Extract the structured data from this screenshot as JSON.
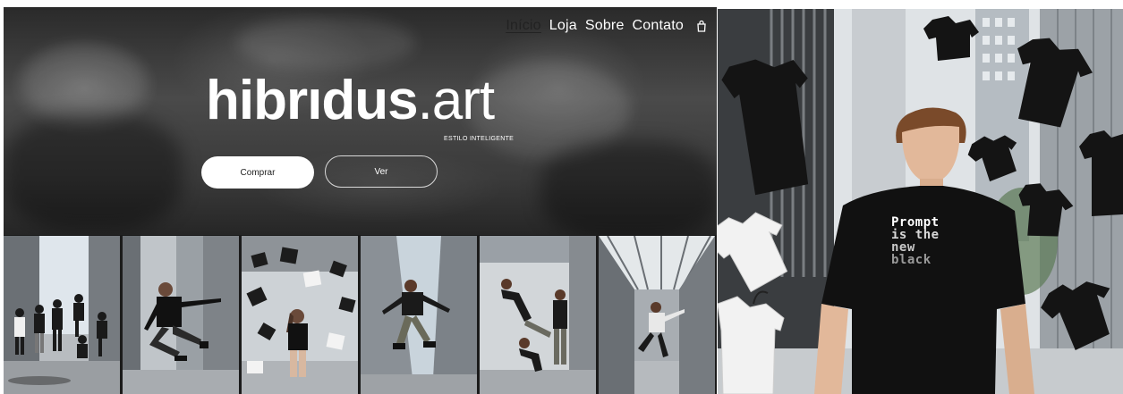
{
  "nav": {
    "items": [
      "Início",
      "Loja",
      "Sobre",
      "Contato"
    ],
    "active_index": 0,
    "cart_icon": "shopping-bag-icon"
  },
  "hero": {
    "logo_bold": "hibrıdus",
    "logo_thin": ".art",
    "tagline": "ESTILO INTELIGENTE",
    "buy_label": "Comprar",
    "view_label": "Ver"
  },
  "gallery": {
    "count": 6
  },
  "feature": {
    "shirt_text_lines": [
      "Prompt",
      "is the",
      "new",
      "black"
    ]
  },
  "colors": {
    "hero_dark": "#2a2a2a",
    "button_bg": "#ffffff",
    "shirt": "#111111"
  }
}
